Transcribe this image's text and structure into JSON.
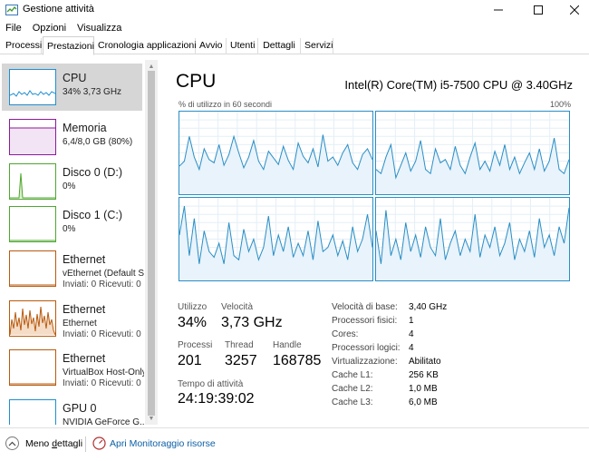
{
  "window": {
    "title": "Gestione attività"
  },
  "menu": [
    "File",
    "Opzioni",
    "Visualizza"
  ],
  "tabs": [
    "Processi",
    "Prestazioni",
    "Cronologia applicazioni",
    "Avvio",
    "Utenti",
    "Dettagli",
    "Servizi"
  ],
  "active_tab": "Prestazioni",
  "sidebar": {
    "items": [
      {
        "title": "CPU",
        "sub1": "34% 3,73 GHz",
        "sub2": "",
        "color": "#1e8fd0"
      },
      {
        "title": "Memoria",
        "sub1": "6,4/8,0 GB (80%)",
        "sub2": "",
        "color": "#8b1a9a"
      },
      {
        "title": "Disco 0 (D:)",
        "sub1": "0%",
        "sub2": "",
        "color": "#4ea72e"
      },
      {
        "title": "Disco 1 (C:)",
        "sub1": "0%",
        "sub2": "",
        "color": "#4ea72e"
      },
      {
        "title": "Ethernet",
        "sub1": "vEthernet (Default Sv",
        "sub2": "Inviati: 0 Ricevuti: 0 I",
        "color": "#b85a0e"
      },
      {
        "title": "Ethernet",
        "sub1": "Ethernet",
        "sub2": "Inviati: 0 Ricevuti: 0 I",
        "color": "#b85a0e"
      },
      {
        "title": "Ethernet",
        "sub1": "VirtualBox Host-Only",
        "sub2": "Inviati: 0 Ricevuti: 0 I",
        "color": "#b85a0e"
      },
      {
        "title": "GPU 0",
        "sub1": "NVIDIA GeForce G...",
        "sub2": "",
        "color": "#1e8fd0"
      }
    ]
  },
  "main": {
    "title": "CPU",
    "model": "Intel(R) Core(TM) i5-7500 CPU @ 3.40GHz",
    "graph_caption": "% di utilizzo in 60 secondi",
    "graph_max": "100%",
    "stats": {
      "utilizzo_label": "Utilizzo",
      "utilizzo_value": "34%",
      "velocita_label": "Velocità",
      "velocita_value": "3,73 GHz",
      "processi_label": "Processi",
      "processi_value": "201",
      "thread_label": "Thread",
      "thread_value": "3257",
      "handle_label": "Handle",
      "handle_value": "168785",
      "tempo_label": "Tempo di attività",
      "tempo_value": "24:19:39:02"
    },
    "info": [
      {
        "label": "Velocità di base:",
        "value": "3,40 GHz"
      },
      {
        "label": "Processori fisici:",
        "value": "1"
      },
      {
        "label": "Cores:",
        "value": "4"
      },
      {
        "label": "Processori logici:",
        "value": "4"
      },
      {
        "label": "Virtualizzazione:",
        "value": "Abilitato"
      },
      {
        "label": "Cache L1:",
        "value": "256 KB"
      },
      {
        "label": "Cache L2:",
        "value": "1,0 MB"
      },
      {
        "label": "Cache L3:",
        "value": "6,0 MB"
      }
    ],
    "core_utilization": [
      [
        34,
        40,
        70,
        45,
        30,
        55,
        42,
        38,
        60,
        35,
        48,
        70,
        50,
        32,
        45,
        65,
        40,
        30,
        52,
        44,
        36,
        58,
        41,
        30,
        62,
        46,
        38,
        55,
        33,
        72,
        40,
        45,
        35,
        50,
        60,
        38,
        30,
        48,
        55,
        42
      ],
      [
        30,
        25,
        45,
        60,
        20,
        35,
        50,
        28,
        40,
        65,
        30,
        25,
        55,
        38,
        42,
        30,
        58,
        35,
        25,
        45,
        62,
        30,
        40,
        28,
        52,
        35,
        60,
        30,
        45,
        25,
        38,
        50,
        30,
        55,
        28,
        40,
        68,
        30,
        25,
        42
      ],
      [
        55,
        90,
        30,
        75,
        20,
        60,
        35,
        28,
        45,
        20,
        70,
        30,
        25,
        62,
        35,
        50,
        25,
        40,
        78,
        30,
        55,
        35,
        65,
        28,
        45,
        30,
        60,
        25,
        72,
        35,
        40,
        55,
        30,
        48,
        25,
        65,
        35,
        50,
        80,
        40
      ],
      [
        60,
        20,
        85,
        30,
        50,
        25,
        70,
        35,
        55,
        28,
        65,
        40,
        30,
        75,
        25,
        45,
        60,
        30,
        50,
        35,
        80,
        28,
        55,
        40,
        65,
        30,
        45,
        70,
        25,
        50,
        35,
        60,
        28,
        75,
        40,
        55,
        30,
        65,
        45,
        88
      ]
    ]
  }
}
